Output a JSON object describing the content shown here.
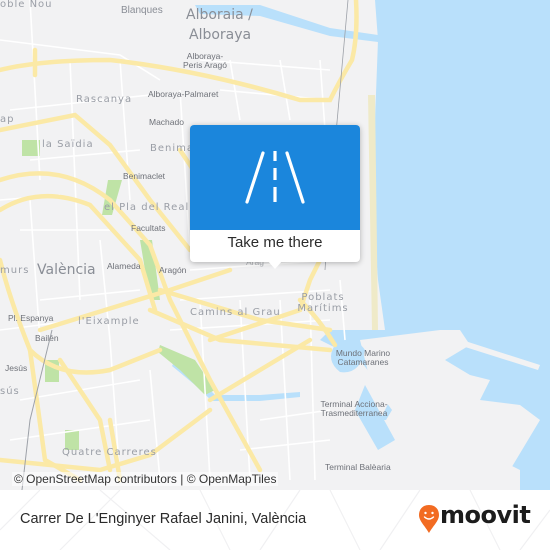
{
  "map": {
    "labels": {
      "poble_nou": "oble Nou",
      "tavernes_blanques": "Blanques",
      "alboraia": "Alboraia /",
      "alboraya": "Alboraya",
      "alboraya_peris_arago_1": "Alboraya-",
      "alboraya_peris_arago_2": "Peris Aragó",
      "alboraya_palmaret": "Alboraya-Palmaret",
      "rascanya": "Rascanya",
      "machado": "Machado",
      "ap": "ap",
      "la_saidia": "la Saïdia",
      "benimaclet_district": "Benima",
      "benimaclet": "Benimaclet",
      "el_pla_del_real": "el Pla del Real",
      "facultats": "Facultats",
      "murs": "murs",
      "valencia": "València",
      "alameda": "Alameda",
      "aragon": "Aragón",
      "arago_partial": "Arag",
      "camins_al_grau": "Camins al Grau",
      "poblats_1": "Poblats",
      "poblats_2": "Marítims",
      "pl_espanya": "Pl. Espanya",
      "eixample": "l'Eixample",
      "bailen": "Bailén",
      "jesus_station": "Jesús",
      "jesus_district": "sús",
      "mundo_marino_1": "Mundo Marino",
      "mundo_marino_2": "Catamaranes",
      "terminal_acciona_1": "Terminal Acciona-",
      "terminal_acciona_2": "Trasmediterranea",
      "quatre_carreres": "Quatre Carreres",
      "terminal_balearia": "Terminal Balèaria"
    },
    "colors": {
      "land": "#f2f2f3",
      "water": "#b9e0fb",
      "major_road": "#fbe9a6",
      "minor_road": "#ffffff",
      "park": "#bfe3a6"
    },
    "attribution": "© OpenStreetMap contributors | © OpenMapTiles"
  },
  "popup": {
    "icon": "road-icon",
    "action_label": "Take me there",
    "color": "#1b86dc"
  },
  "footer": {
    "title": "Carrer De L'Enginyer Rafael Janini, València",
    "brand": "moovit",
    "brand_color": "#f26b22"
  }
}
